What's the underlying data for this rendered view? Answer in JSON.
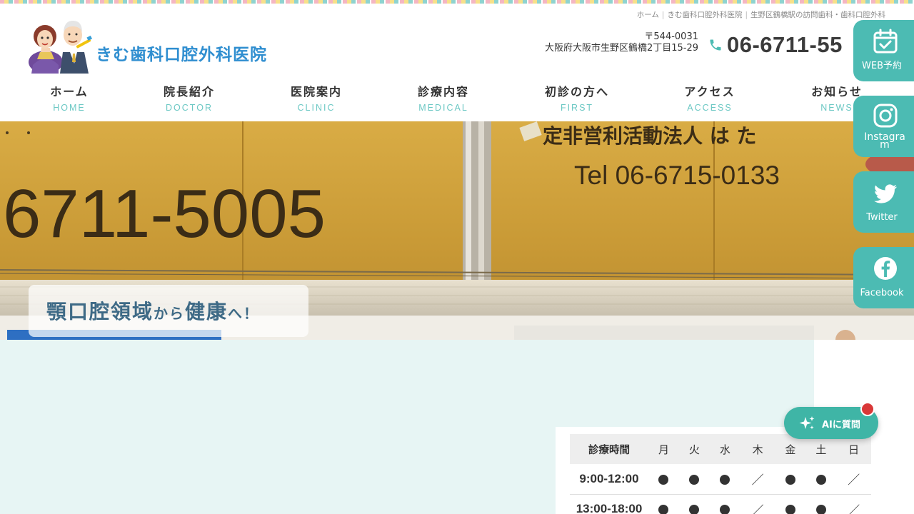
{
  "breadcrumb": {
    "home": "ホーム",
    "clinic": "きむ歯科口腔外科医院",
    "current": "生野区鶴橋駅の訪問歯科・歯科口腔外科"
  },
  "logo": {
    "name": "きむ歯科口腔外科医院"
  },
  "contact": {
    "postal": "〒544-0031",
    "address": "大阪府大阪市生野区鶴橋2丁目15-29",
    "phone": "06-6711-55"
  },
  "nav": {
    "items": [
      {
        "ja": "ホーム",
        "en": "HOME"
      },
      {
        "ja": "院長紹介",
        "en": "DOCTOR"
      },
      {
        "ja": "医院案内",
        "en": "CLINIC"
      },
      {
        "ja": "診療内容",
        "en": "MEDICAL"
      },
      {
        "ja": "初診の方へ",
        "en": "FIRST"
      },
      {
        "ja": "アクセス",
        "en": "ACCESS"
      },
      {
        "ja": "お知らせ",
        "en": "NEWS"
      }
    ]
  },
  "hero": {
    "sign_phone": "6711-5005",
    "sign_org": "定非営利活動法人 は た",
    "sign_tel": "Tel 06-6715-0133",
    "caption_a": "顎口腔領域",
    "caption_b": "から",
    "caption_c": "健康",
    "caption_d": "へ！"
  },
  "side": {
    "web": "WEB予約",
    "instagram": "Instagram",
    "twitter": "Twitter",
    "facebook": "Facebook"
  },
  "ai": {
    "label": "AIに質問"
  },
  "schedule": {
    "header": [
      "診療時間",
      "月",
      "火",
      "水",
      "木",
      "金",
      "土",
      "日"
    ],
    "rows": [
      {
        "time": "9:00-12:00",
        "marks": [
          "●",
          "●",
          "●",
          "／",
          "●",
          "●",
          "／"
        ]
      },
      {
        "time": "13:00-18:00",
        "marks": [
          "●",
          "●",
          "●",
          "／",
          "●",
          "●",
          "／"
        ]
      }
    ]
  },
  "colors": {
    "accent": "#4cbbb3",
    "logo_blue": "#2f8ed0",
    "nav_en": "#6cc8c4",
    "lower_bg": "#e7f5f4",
    "hero_wall": "#d4a53f"
  }
}
